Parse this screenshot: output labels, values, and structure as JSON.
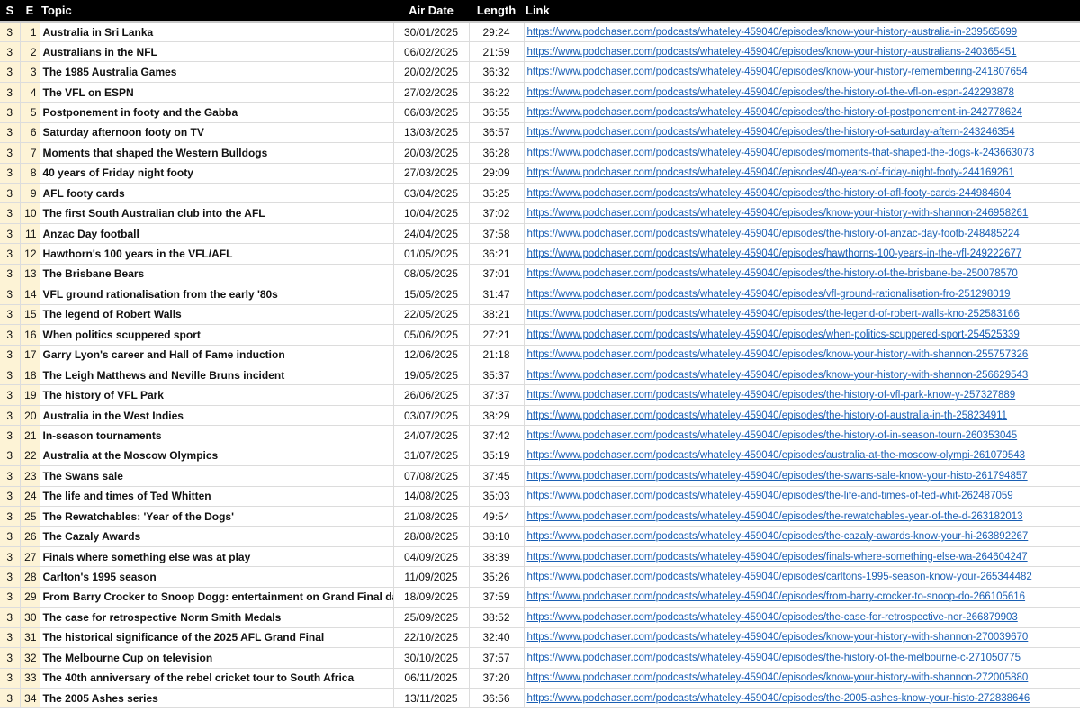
{
  "headers": {
    "s": "S",
    "e": "E",
    "topic": "Topic",
    "air_date": "Air Date",
    "length": "Length",
    "link": "Link"
  },
  "rows": [
    {
      "s": "3",
      "e": "1",
      "topic": "Australia in Sri Lanka",
      "date": "30/01/2025",
      "length": "29:24",
      "link": "https://www.podchaser.com/podcasts/whateley-459040/episodes/know-your-history-australia-in-239565699"
    },
    {
      "s": "3",
      "e": "2",
      "topic": "Australians in the NFL",
      "date": "06/02/2025",
      "length": "21:59",
      "link": "https://www.podchaser.com/podcasts/whateley-459040/episodes/know-your-history-australians-240365451"
    },
    {
      "s": "3",
      "e": "3",
      "topic": "The 1985 Australia Games",
      "date": "20/02/2025",
      "length": "36:32",
      "link": "https://www.podchaser.com/podcasts/whateley-459040/episodes/know-your-history-remembering-241807654"
    },
    {
      "s": "3",
      "e": "4",
      "topic": "The VFL on ESPN",
      "date": "27/02/2025",
      "length": "36:22",
      "link": "https://www.podchaser.com/podcasts/whateley-459040/episodes/the-history-of-the-vfl-on-espn-242293878"
    },
    {
      "s": "3",
      "e": "5",
      "topic": "Postponement in footy and the Gabba",
      "date": "06/03/2025",
      "length": "36:55",
      "link": "https://www.podchaser.com/podcasts/whateley-459040/episodes/the-history-of-postponement-in-242778624"
    },
    {
      "s": "3",
      "e": "6",
      "topic": "Saturday afternoon footy on TV",
      "date": "13/03/2025",
      "length": "36:57",
      "link": "https://www.podchaser.com/podcasts/whateley-459040/episodes/the-history-of-saturday-aftern-243246354"
    },
    {
      "s": "3",
      "e": "7",
      "topic": "Moments that shaped the Western Bulldogs",
      "date": "20/03/2025",
      "length": "36:28",
      "link": "https://www.podchaser.com/podcasts/whateley-459040/episodes/moments-that-shaped-the-dogs-k-243663073"
    },
    {
      "s": "3",
      "e": "8",
      "topic": "40 years of Friday night footy",
      "date": "27/03/2025",
      "length": "29:09",
      "link": "https://www.podchaser.com/podcasts/whateley-459040/episodes/40-years-of-friday-night-footy-244169261"
    },
    {
      "s": "3",
      "e": "9",
      "topic": "AFL footy cards",
      "date": "03/04/2025",
      "length": "35:25",
      "link": "https://www.podchaser.com/podcasts/whateley-459040/episodes/the-history-of-afl-footy-cards-244984604"
    },
    {
      "s": "3",
      "e": "10",
      "topic": "The first South Australian club into the AFL",
      "date": "10/04/2025",
      "length": "37:02",
      "link": "https://www.podchaser.com/podcasts/whateley-459040/episodes/know-your-history-with-shannon-246958261"
    },
    {
      "s": "3",
      "e": "11",
      "topic": "Anzac Day football",
      "date": "24/04/2025",
      "length": "37:58",
      "link": "https://www.podchaser.com/podcasts/whateley-459040/episodes/the-history-of-anzac-day-footb-248485224"
    },
    {
      "s": "3",
      "e": "12",
      "topic": "Hawthorn's 100 years in the VFL/AFL",
      "date": "01/05/2025",
      "length": "36:21",
      "link": "https://www.podchaser.com/podcasts/whateley-459040/episodes/hawthorns-100-years-in-the-vfl-249222677"
    },
    {
      "s": "3",
      "e": "13",
      "topic": "The Brisbane Bears",
      "date": "08/05/2025",
      "length": "37:01",
      "link": "https://www.podchaser.com/podcasts/whateley-459040/episodes/the-history-of-the-brisbane-be-250078570"
    },
    {
      "s": "3",
      "e": "14",
      "topic": "VFL ground rationalisation from the early '80s",
      "date": "15/05/2025",
      "length": "31:47",
      "link": "https://www.podchaser.com/podcasts/whateley-459040/episodes/vfl-ground-rationalisation-fro-251298019"
    },
    {
      "s": "3",
      "e": "15",
      "topic": "The legend of Robert Walls",
      "date": "22/05/2025",
      "length": "38:21",
      "link": "https://www.podchaser.com/podcasts/whateley-459040/episodes/the-legend-of-robert-walls-kno-252583166"
    },
    {
      "s": "3",
      "e": "16",
      "topic": "When politics scuppered sport",
      "date": "05/06/2025",
      "length": "27:21",
      "link": "https://www.podchaser.com/podcasts/whateley-459040/episodes/when-politics-scuppered-sport-254525339"
    },
    {
      "s": "3",
      "e": "17",
      "topic": "Garry Lyon's career and Hall of Fame induction",
      "date": "12/06/2025",
      "length": "21:18",
      "link": "https://www.podchaser.com/podcasts/whateley-459040/episodes/know-your-history-with-shannon-255757326"
    },
    {
      "s": "3",
      "e": "18",
      "topic": "The Leigh Matthews and Neville Bruns incident",
      "date": "19/05/2025",
      "length": "35:37",
      "link": "https://www.podchaser.com/podcasts/whateley-459040/episodes/know-your-history-with-shannon-256629543"
    },
    {
      "s": "3",
      "e": "19",
      "topic": "The history of VFL Park",
      "date": "26/06/2025",
      "length": "37:37",
      "link": "https://www.podchaser.com/podcasts/whateley-459040/episodes/the-history-of-vfl-park-know-y-257327889"
    },
    {
      "s": "3",
      "e": "20",
      "topic": "Australia in the West Indies",
      "date": "03/07/2025",
      "length": "38:29",
      "link": "https://www.podchaser.com/podcasts/whateley-459040/episodes/the-history-of-australia-in-th-258234911"
    },
    {
      "s": "3",
      "e": "21",
      "topic": "In-season tournaments",
      "date": "24/07/2025",
      "length": "37:42",
      "link": "https://www.podchaser.com/podcasts/whateley-459040/episodes/the-history-of-in-season-tourn-260353045"
    },
    {
      "s": "3",
      "e": "22",
      "topic": "Australia at the Moscow Olympics",
      "date": "31/07/2025",
      "length": "35:19",
      "link": "https://www.podchaser.com/podcasts/whateley-459040/episodes/australia-at-the-moscow-olympi-261079543"
    },
    {
      "s": "3",
      "e": "23",
      "topic": "The Swans sale",
      "date": "07/08/2025",
      "length": "37:45",
      "link": "https://www.podchaser.com/podcasts/whateley-459040/episodes/the-swans-sale-know-your-histo-261794857"
    },
    {
      "s": "3",
      "e": "24",
      "topic": "The life and times of Ted Whitten",
      "date": "14/08/2025",
      "length": "35:03",
      "link": "https://www.podchaser.com/podcasts/whateley-459040/episodes/the-life-and-times-of-ted-whit-262487059"
    },
    {
      "s": "3",
      "e": "25",
      "topic": "The Rewatchables: 'Year of the Dogs'",
      "date": "21/08/2025",
      "length": "49:54",
      "link": "https://www.podchaser.com/podcasts/whateley-459040/episodes/the-rewatchables-year-of-the-d-263182013"
    },
    {
      "s": "3",
      "e": "26",
      "topic": "The Cazaly Awards",
      "date": "28/08/2025",
      "length": "38:10",
      "link": "https://www.podchaser.com/podcasts/whateley-459040/episodes/the-cazaly-awards-know-your-hi-263892267"
    },
    {
      "s": "3",
      "e": "27",
      "topic": "Finals where something else was at play",
      "date": "04/09/2025",
      "length": "38:39",
      "link": "https://www.podchaser.com/podcasts/whateley-459040/episodes/finals-where-something-else-wa-264604247"
    },
    {
      "s": "3",
      "e": "28",
      "topic": "Carlton's 1995 season",
      "date": "11/09/2025",
      "length": "35:26",
      "link": "https://www.podchaser.com/podcasts/whateley-459040/episodes/carltons-1995-season-know-your-265344482"
    },
    {
      "s": "3",
      "e": "29",
      "topic": "From Barry Crocker to Snoop Dogg: entertainment on Grand Final day",
      "date": "18/09/2025",
      "length": "37:59",
      "link": "https://www.podchaser.com/podcasts/whateley-459040/episodes/from-barry-crocker-to-snoop-do-266105616"
    },
    {
      "s": "3",
      "e": "30",
      "topic": "The case for retrospective Norm Smith Medals",
      "date": "25/09/2025",
      "length": "38:52",
      "link": "https://www.podchaser.com/podcasts/whateley-459040/episodes/the-case-for-retrospective-nor-266879903"
    },
    {
      "s": "3",
      "e": "31",
      "topic": "The historical significance of the 2025 AFL Grand Final",
      "date": "22/10/2025",
      "length": "32:40",
      "link": "https://www.podchaser.com/podcasts/whateley-459040/episodes/know-your-history-with-shannon-270039670"
    },
    {
      "s": "3",
      "e": "32",
      "topic": "The Melbourne Cup on television",
      "date": "30/10/2025",
      "length": "37:57",
      "link": "https://www.podchaser.com/podcasts/whateley-459040/episodes/the-history-of-the-melbourne-c-271050775"
    },
    {
      "s": "3",
      "e": "33",
      "topic": "The 40th anniversary of the rebel cricket tour to South Africa",
      "date": "06/11/2025",
      "length": "37:20",
      "link": "https://www.podchaser.com/podcasts/whateley-459040/episodes/know-your-history-with-shannon-272005880"
    },
    {
      "s": "3",
      "e": "34",
      "topic": "The 2005 Ashes series",
      "date": "13/11/2025",
      "length": "36:56",
      "link": "https://www.podchaser.com/podcasts/whateley-459040/episodes/the-2005-ashes-know-your-histo-272838646"
    }
  ]
}
